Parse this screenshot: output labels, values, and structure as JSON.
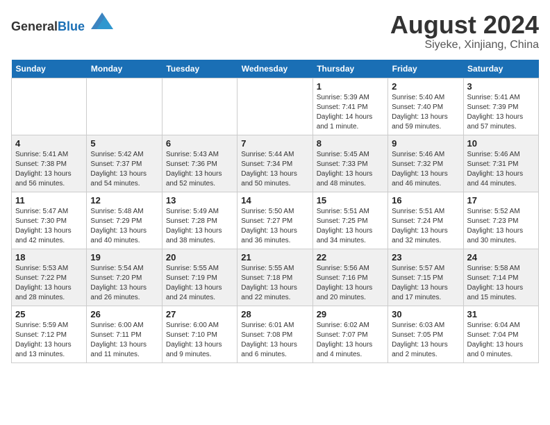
{
  "header": {
    "logo_line1": "General",
    "logo_line2": "Blue",
    "month_year": "August 2024",
    "location": "Siyeke, Xinjiang, China"
  },
  "days_of_week": [
    "Sunday",
    "Monday",
    "Tuesday",
    "Wednesday",
    "Thursday",
    "Friday",
    "Saturday"
  ],
  "weeks": [
    {
      "days": [
        {
          "number": "",
          "info": ""
        },
        {
          "number": "",
          "info": ""
        },
        {
          "number": "",
          "info": ""
        },
        {
          "number": "",
          "info": ""
        },
        {
          "number": "1",
          "info": "Sunrise: 5:39 AM\nSunset: 7:41 PM\nDaylight: 14 hours\nand 1 minute."
        },
        {
          "number": "2",
          "info": "Sunrise: 5:40 AM\nSunset: 7:40 PM\nDaylight: 13 hours\nand 59 minutes."
        },
        {
          "number": "3",
          "info": "Sunrise: 5:41 AM\nSunset: 7:39 PM\nDaylight: 13 hours\nand 57 minutes."
        }
      ]
    },
    {
      "days": [
        {
          "number": "4",
          "info": "Sunrise: 5:41 AM\nSunset: 7:38 PM\nDaylight: 13 hours\nand 56 minutes."
        },
        {
          "number": "5",
          "info": "Sunrise: 5:42 AM\nSunset: 7:37 PM\nDaylight: 13 hours\nand 54 minutes."
        },
        {
          "number": "6",
          "info": "Sunrise: 5:43 AM\nSunset: 7:36 PM\nDaylight: 13 hours\nand 52 minutes."
        },
        {
          "number": "7",
          "info": "Sunrise: 5:44 AM\nSunset: 7:34 PM\nDaylight: 13 hours\nand 50 minutes."
        },
        {
          "number": "8",
          "info": "Sunrise: 5:45 AM\nSunset: 7:33 PM\nDaylight: 13 hours\nand 48 minutes."
        },
        {
          "number": "9",
          "info": "Sunrise: 5:46 AM\nSunset: 7:32 PM\nDaylight: 13 hours\nand 46 minutes."
        },
        {
          "number": "10",
          "info": "Sunrise: 5:46 AM\nSunset: 7:31 PM\nDaylight: 13 hours\nand 44 minutes."
        }
      ]
    },
    {
      "days": [
        {
          "number": "11",
          "info": "Sunrise: 5:47 AM\nSunset: 7:30 PM\nDaylight: 13 hours\nand 42 minutes."
        },
        {
          "number": "12",
          "info": "Sunrise: 5:48 AM\nSunset: 7:29 PM\nDaylight: 13 hours\nand 40 minutes."
        },
        {
          "number": "13",
          "info": "Sunrise: 5:49 AM\nSunset: 7:28 PM\nDaylight: 13 hours\nand 38 minutes."
        },
        {
          "number": "14",
          "info": "Sunrise: 5:50 AM\nSunset: 7:27 PM\nDaylight: 13 hours\nand 36 minutes."
        },
        {
          "number": "15",
          "info": "Sunrise: 5:51 AM\nSunset: 7:25 PM\nDaylight: 13 hours\nand 34 minutes."
        },
        {
          "number": "16",
          "info": "Sunrise: 5:51 AM\nSunset: 7:24 PM\nDaylight: 13 hours\nand 32 minutes."
        },
        {
          "number": "17",
          "info": "Sunrise: 5:52 AM\nSunset: 7:23 PM\nDaylight: 13 hours\nand 30 minutes."
        }
      ]
    },
    {
      "days": [
        {
          "number": "18",
          "info": "Sunrise: 5:53 AM\nSunset: 7:22 PM\nDaylight: 13 hours\nand 28 minutes."
        },
        {
          "number": "19",
          "info": "Sunrise: 5:54 AM\nSunset: 7:20 PM\nDaylight: 13 hours\nand 26 minutes."
        },
        {
          "number": "20",
          "info": "Sunrise: 5:55 AM\nSunset: 7:19 PM\nDaylight: 13 hours\nand 24 minutes."
        },
        {
          "number": "21",
          "info": "Sunrise: 5:55 AM\nSunset: 7:18 PM\nDaylight: 13 hours\nand 22 minutes."
        },
        {
          "number": "22",
          "info": "Sunrise: 5:56 AM\nSunset: 7:16 PM\nDaylight: 13 hours\nand 20 minutes."
        },
        {
          "number": "23",
          "info": "Sunrise: 5:57 AM\nSunset: 7:15 PM\nDaylight: 13 hours\nand 17 minutes."
        },
        {
          "number": "24",
          "info": "Sunrise: 5:58 AM\nSunset: 7:14 PM\nDaylight: 13 hours\nand 15 minutes."
        }
      ]
    },
    {
      "days": [
        {
          "number": "25",
          "info": "Sunrise: 5:59 AM\nSunset: 7:12 PM\nDaylight: 13 hours\nand 13 minutes."
        },
        {
          "number": "26",
          "info": "Sunrise: 6:00 AM\nSunset: 7:11 PM\nDaylight: 13 hours\nand 11 minutes."
        },
        {
          "number": "27",
          "info": "Sunrise: 6:00 AM\nSunset: 7:10 PM\nDaylight: 13 hours\nand 9 minutes."
        },
        {
          "number": "28",
          "info": "Sunrise: 6:01 AM\nSunset: 7:08 PM\nDaylight: 13 hours\nand 6 minutes."
        },
        {
          "number": "29",
          "info": "Sunrise: 6:02 AM\nSunset: 7:07 PM\nDaylight: 13 hours\nand 4 minutes."
        },
        {
          "number": "30",
          "info": "Sunrise: 6:03 AM\nSunset: 7:05 PM\nDaylight: 13 hours\nand 2 minutes."
        },
        {
          "number": "31",
          "info": "Sunrise: 6:04 AM\nSunset: 7:04 PM\nDaylight: 13 hours\nand 0 minutes."
        }
      ]
    }
  ]
}
